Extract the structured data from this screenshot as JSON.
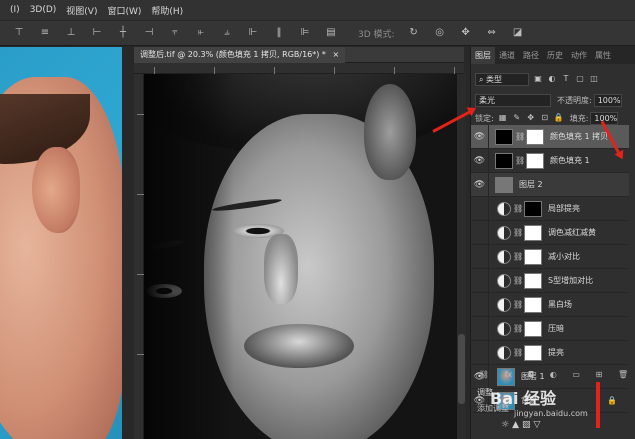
{
  "menubar": {
    "items": [
      "(I)",
      "3D(D)",
      "视图(V)",
      "窗口(W)",
      "帮助(H)"
    ]
  },
  "options": {
    "mode3d": "3D 模式:"
  },
  "document": {
    "tab_title": "调整后.tif @ 20.3% (颜色填充 1 拷贝, RGB/16*) *",
    "close": "×"
  },
  "layers_panel": {
    "tabs": [
      "图层",
      "通道",
      "路径",
      "历史",
      "动作",
      "属性"
    ],
    "active_tab": "图层",
    "filter_kind": "类型",
    "blend_mode": "柔光",
    "opacity_label": "不透明度:",
    "opacity_value": "100%",
    "lock_label": "锁定:",
    "fill_label": "填充:",
    "fill_value": "100%",
    "layers": [
      {
        "name": "颜色填充 1 拷贝",
        "kind": "fill",
        "visible": true,
        "selected": true
      },
      {
        "name": "颜色填充 1",
        "kind": "fill",
        "visible": true
      },
      {
        "name": "图层 2",
        "kind": "group",
        "visible": true
      },
      {
        "name": "局部提亮",
        "kind": "adjust",
        "visible": false
      },
      {
        "name": "调色减红减黄",
        "kind": "adjust",
        "visible": false
      },
      {
        "name": "减小对比",
        "kind": "adjust",
        "visible": false
      },
      {
        "name": "S型增加对比",
        "kind": "adjust",
        "visible": false
      },
      {
        "name": "黑白场",
        "kind": "adjust",
        "visible": false
      },
      {
        "name": "压暗",
        "kind": "adjust",
        "visible": false
      },
      {
        "name": "提亮",
        "kind": "adjust",
        "visible": false
      },
      {
        "name": "图层 1",
        "kind": "photo",
        "visible": true
      },
      {
        "name": "背景",
        "kind": "photo",
        "visible": true,
        "locked": true
      }
    ],
    "footer_icons": [
      "link-icon",
      "fx-icon",
      "mask-icon",
      "adjustment-icon",
      "folder-icon",
      "new-layer-icon",
      "trash-icon"
    ],
    "footer_fx": "fx"
  },
  "adjustments": {
    "title": "调整",
    "subtitle": "添加调整"
  },
  "watermark": {
    "brand": "Bai 经验",
    "url": "jingyan.baidu.com"
  },
  "colors": {
    "accent_red": "#e2231a",
    "panel_bg": "#2f2f2f",
    "selected_layer": "#5a5a5a"
  }
}
